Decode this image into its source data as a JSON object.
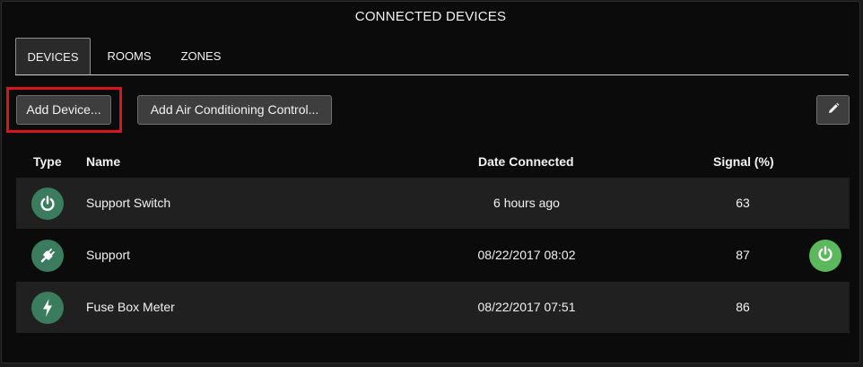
{
  "title": "CONNECTED DEVICES",
  "tabs": [
    {
      "label": "DEVICES",
      "active": true
    },
    {
      "label": "ROOMS",
      "active": false
    },
    {
      "label": "ZONES",
      "active": false
    }
  ],
  "toolbar": {
    "add_device_label": "Add Device...",
    "add_ac_label": "Add Air Conditioning Control...",
    "edit_icon": "pencil-icon",
    "highlight_color": "#d9141c"
  },
  "table": {
    "headers": {
      "type": "Type",
      "name": "Name",
      "date": "Date Connected",
      "signal": "Signal (%)"
    },
    "rows": [
      {
        "type_icon": "power-icon",
        "name": "Support Switch",
        "date": "6 hours ago",
        "signal": "63",
        "power_button": false
      },
      {
        "type_icon": "plug-icon",
        "name": "Support",
        "date": "08/22/2017 08:02",
        "signal": "87",
        "power_button": true
      },
      {
        "type_icon": "lightning-icon",
        "name": "Fuse Box Meter",
        "date": "08/22/2017 07:51",
        "signal": "86",
        "power_button": false
      }
    ]
  },
  "colors": {
    "type_icon_bg": "#3b7b5e",
    "power_button_bg": "#5cb85c",
    "panel_bg": "#0b0b0b",
    "row_alt_bg": "#202020"
  }
}
